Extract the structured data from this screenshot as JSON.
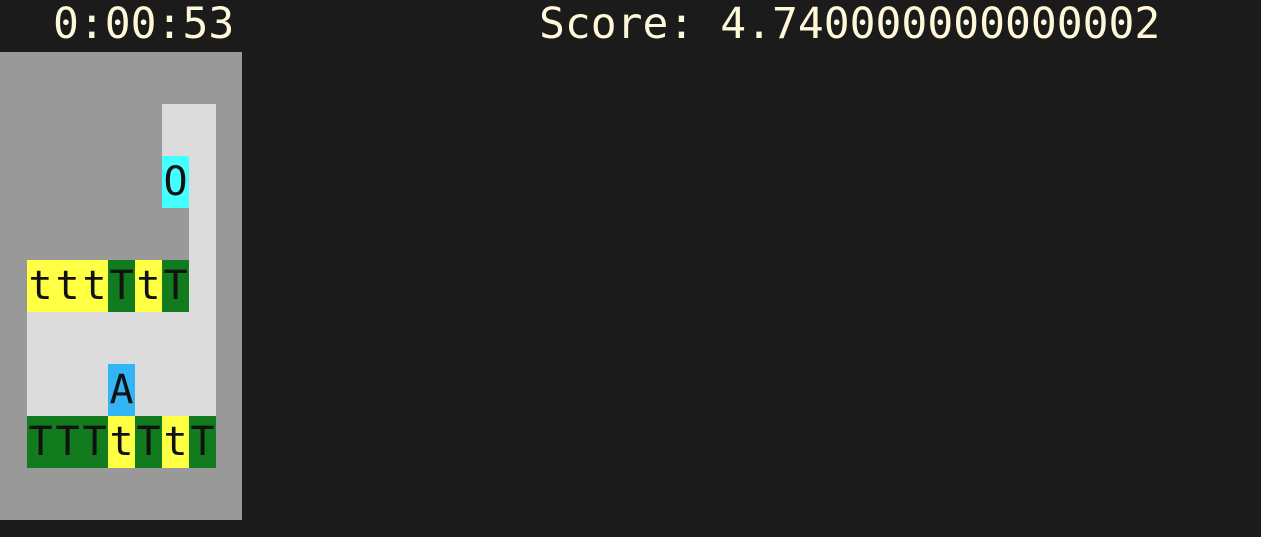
{
  "hud": {
    "timer": "0:00:53",
    "score": "Score: 4.740000000000002"
  },
  "colors": {
    "background": "#1b1b1b",
    "wall": "#999999",
    "floor": "#dcdcdc",
    "tree": "#127b1d",
    "small_tree": "#ffff44",
    "agent": "#33b5f5",
    "goal": "#44ffff",
    "text": "#fff8d8"
  },
  "legend": {
    "#": "wall",
    ".": "floor",
    "T": "tree",
    "t": "small_tree",
    "A": "agent",
    "O": "goal"
  },
  "grid": [
    "#########",
    "######..#",
    "######O.#",
    "#######.#",
    "#tttTtT.#",
    "#.......#",
    "#...A...#",
    "#TTTtTtT#",
    "#########"
  ]
}
